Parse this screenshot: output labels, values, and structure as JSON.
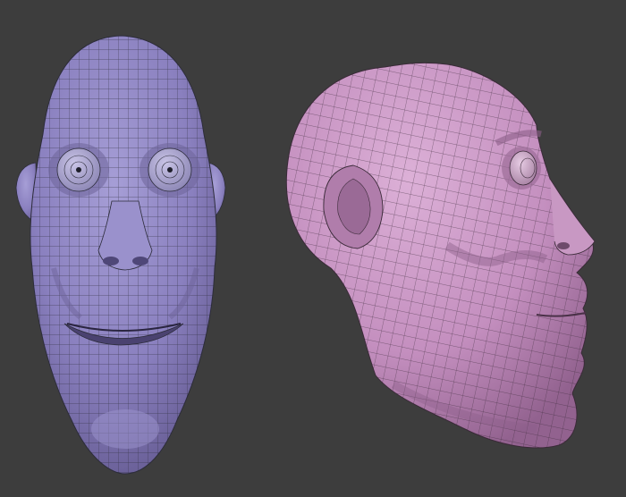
{
  "scene": {
    "background": "#3d3d3d",
    "wire_color": "#2c2c3a",
    "views": [
      {
        "name": "front-view",
        "subject": "head-front-icon",
        "face_color": "#8a80bf",
        "shadow_color": "#6e6499",
        "highlight_color": "#a69ed6"
      },
      {
        "name": "side-view",
        "subject": "head-profile-icon",
        "face_color": "#c48fbf",
        "shadow_color": "#9d6e99",
        "highlight_color": "#d9abd4"
      }
    ]
  }
}
